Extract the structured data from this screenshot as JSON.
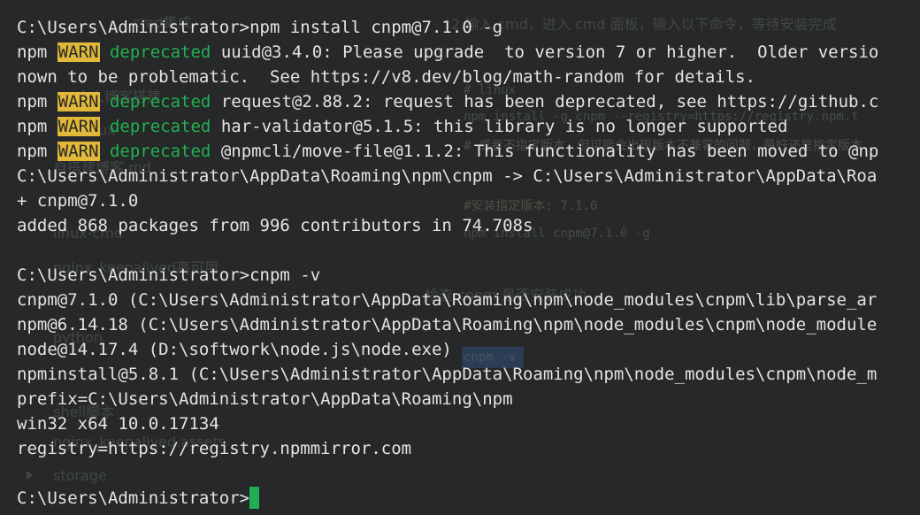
{
  "background": {
    "items": [
      {
        "name": "bg-text-instruction",
        "text": "2.输入 cmd，进入 cmd 面板，输入以下命令，等待安装完成"
      },
      {
        "name": "bg-text-blog-tool",
        "text": "cmd集成"
      },
      {
        "name": "bg-text-linux",
        "text": "# linux"
      },
      {
        "name": "bg-text-personal-blog",
        "text": "个人博客搭建"
      },
      {
        "name": "bg-text-npm-registry",
        "text": "npm install -g cnpm --registry=https://registry.npm.t"
      },
      {
        "name": "bg-text-install-note",
        "text": "# 或者不指定版本，但可能会出现版本不兼容的问题，最好还是指定版本"
      },
      {
        "name": "bg-text-linux-sub",
        "text": "linux"
      },
      {
        "name": "bg-text-blog-md",
        "text": "自搭建博客.md"
      },
      {
        "name": "bg-text-install-version",
        "text": "#安装指定版本: 7.1.0"
      },
      {
        "name": "bg-text-npm-install-cnpm",
        "text": "npm install cnpm@7.1.0 -g"
      },
      {
        "name": "bg-text-linux-cmd",
        "text": "linux-cmd"
      },
      {
        "name": "bg-text-nginx-keepalived",
        "text": "nginx_keepalived高可用"
      },
      {
        "name": "bg-text-check",
        "text": "检查 cnpm 是否安装成功"
      },
      {
        "name": "bg-text-python",
        "text": "python"
      },
      {
        "name": "bg-text-cnpm-v",
        "text": "cnpm -v"
      },
      {
        "name": "bg-text-shell",
        "text": "shell脚本"
      },
      {
        "name": "bg-text-nginx-assets",
        "text": "nginx_keepalived.assets"
      },
      {
        "name": "bg-text-storage",
        "text": "storage"
      }
    ]
  },
  "terminal": {
    "colors": {
      "background": "#262829",
      "text": "#e4e4e4",
      "warn_bg": "#e2b838",
      "deprecated": "#21b14f",
      "cursor": "#1fb053"
    },
    "lines": [
      {
        "text": "C:\\Users\\Administrator>npm install cnpm@7.1.0 -g"
      },
      {
        "prefix": "npm ",
        "warn": "WARN",
        "dep": " deprecated",
        "rest": " uuid@3.4.0: Please upgrade  to version 7 or higher.  Older versio"
      },
      {
        "text": "nown to be problematic.  See https://v8.dev/blog/math-random for details."
      },
      {
        "prefix": "npm ",
        "warn": "WARN",
        "dep": " deprecated",
        "rest": " request@2.88.2: request has been deprecated, see https://github.c"
      },
      {
        "prefix": "npm ",
        "warn": "WARN",
        "dep": " deprecated",
        "rest": " har-validator@5.1.5: this library is no longer supported"
      },
      {
        "prefix": "npm ",
        "warn": "WARN",
        "dep": " deprecated",
        "rest": " @npmcli/move-file@1.1.2: This functionality has been moved to @np"
      },
      {
        "text": "C:\\Users\\Administrator\\AppData\\Roaming\\npm\\cnpm -> C:\\Users\\Administrator\\AppData\\Roa"
      },
      {
        "text": "+ cnpm@7.1.0"
      },
      {
        "text": "added 868 packages from 996 contributors in 74.708s"
      },
      {
        "text": ""
      },
      {
        "text": "C:\\Users\\Administrator>cnpm -v"
      },
      {
        "text": "cnpm@7.1.0 (C:\\Users\\Administrator\\AppData\\Roaming\\npm\\node_modules\\cnpm\\lib\\parse_ar"
      },
      {
        "text": "npm@6.14.18 (C:\\Users\\Administrator\\AppData\\Roaming\\npm\\node_modules\\cnpm\\node_module"
      },
      {
        "text": "node@14.17.4 (D:\\softwork\\node.js\\node.exe)"
      },
      {
        "text": "npminstall@5.8.1 (C:\\Users\\Administrator\\AppData\\Roaming\\npm\\node_modules\\cnpm\\node_m"
      },
      {
        "text": "prefix=C:\\Users\\Administrator\\AppData\\Roaming\\npm"
      },
      {
        "text": "win32 x64 10.0.17134"
      },
      {
        "text": "registry=https://registry.npmmirror.com"
      },
      {
        "text": ""
      },
      {
        "text": "C:\\Users\\Administrator>"
      }
    ]
  }
}
